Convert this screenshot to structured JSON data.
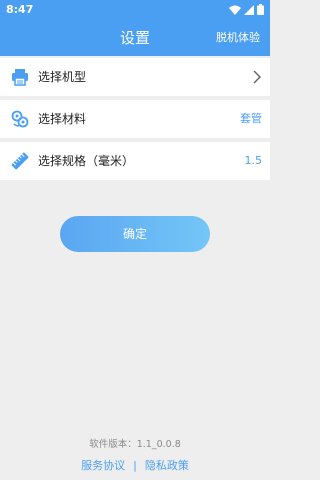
{
  "status_bar": {
    "time": "8:47"
  },
  "header": {
    "title": "设置",
    "right_action": "脱机体验"
  },
  "rows": [
    {
      "label": "选择机型",
      "value": "",
      "icon": "printer-icon",
      "has_chevron": true
    },
    {
      "label": "选择材料",
      "value": "套管",
      "icon": "tube-roll-icon",
      "has_chevron": false
    },
    {
      "label": "选择规格（毫米）",
      "value": "1.5",
      "icon": "ruler-icon",
      "has_chevron": false
    }
  ],
  "confirm_label": "确定",
  "footer": {
    "version_text": "软件版本：1.1_0.0.8",
    "service_agreement": "服务协议",
    "separator": "|",
    "privacy_policy": "隐私政策"
  },
  "colors": {
    "accent": "#4b9ff3",
    "background": "#eeeeee"
  }
}
